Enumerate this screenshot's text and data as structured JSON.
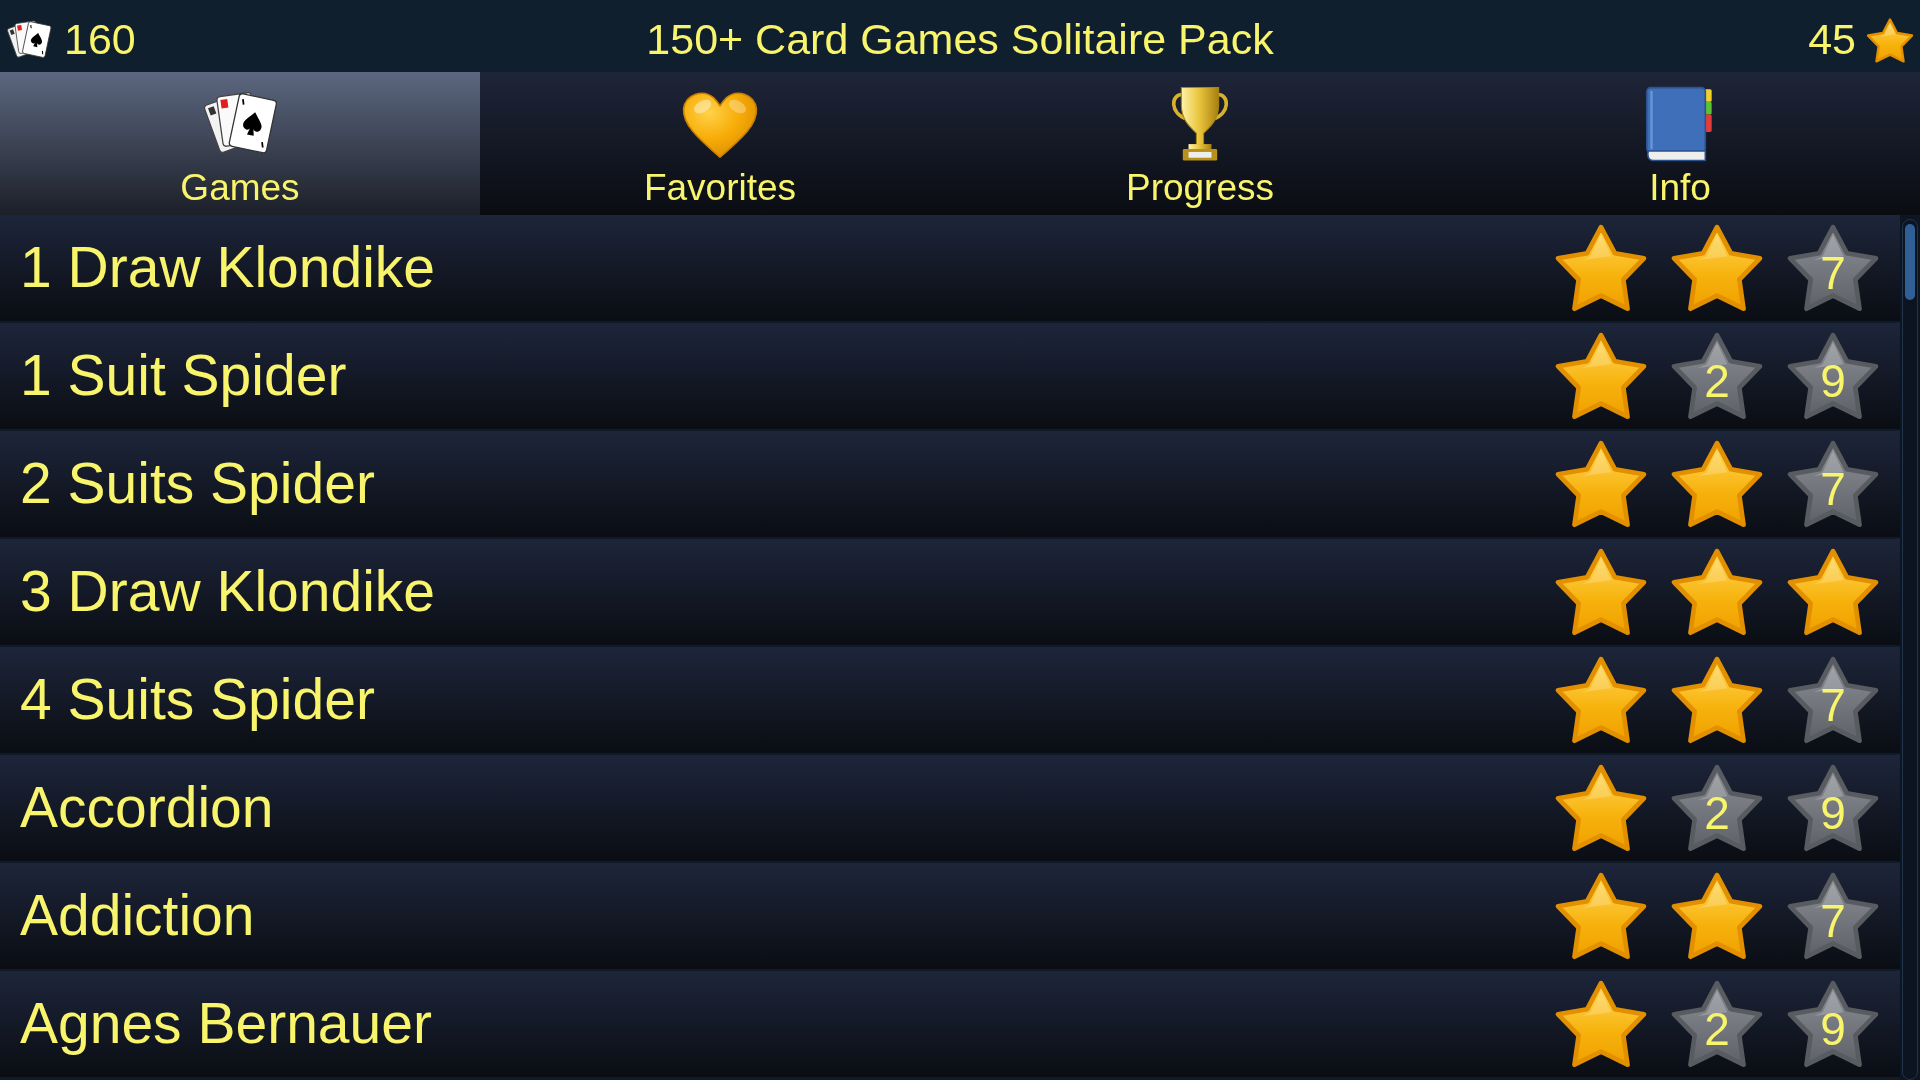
{
  "top_bar": {
    "card_count": "160",
    "title": "150+ Card Games Solitaire Pack",
    "star_count": "45"
  },
  "tabs": [
    {
      "label": "Games",
      "selected": true
    },
    {
      "label": "Favorites",
      "selected": false
    },
    {
      "label": "Progress",
      "selected": false
    },
    {
      "label": "Info",
      "selected": false
    }
  ],
  "games": [
    {
      "name": "1 Draw Klondike",
      "stars": 2,
      "goals": [
        "7"
      ]
    },
    {
      "name": "1 Suit Spider",
      "stars": 1,
      "goals": [
        "2",
        "9"
      ]
    },
    {
      "name": "2 Suits Spider",
      "stars": 2,
      "goals": [
        "7"
      ]
    },
    {
      "name": "3 Draw Klondike",
      "stars": 3
    },
    {
      "name": "4 Suits Spider",
      "stars": 2,
      "goals": [
        "7"
      ]
    },
    {
      "name": "Accordion",
      "stars": 1,
      "goals": [
        "2",
        "9"
      ]
    },
    {
      "name": "Addiction",
      "stars": 2,
      "goals": [
        "7"
      ]
    },
    {
      "name": "Agnes Bernauer",
      "stars": 1,
      "goals": [
        "2",
        "9"
      ]
    }
  ]
}
